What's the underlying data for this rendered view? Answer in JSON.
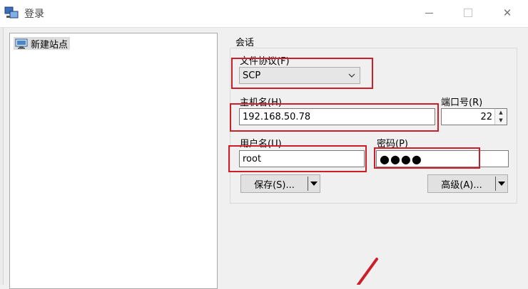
{
  "window": {
    "title": "登录",
    "controls": {
      "minimize_icon": "minimize-icon",
      "maximize_icon": "maximize-icon",
      "close_icon": "close-icon"
    }
  },
  "sidebar": {
    "items": [
      {
        "label": "新建站点",
        "icon": "monitor-icon",
        "selected": true
      }
    ]
  },
  "session": {
    "group_label": "会话",
    "protocol": {
      "label": "文件协议(F)",
      "value": "SCP"
    },
    "host": {
      "label": "主机名(H)",
      "value": "192.168.50.78"
    },
    "port": {
      "label": "端口号(R)",
      "value": "22"
    },
    "user": {
      "label": "用户名(U)",
      "value": "root"
    },
    "password": {
      "label": "密码(P)",
      "value": "●●●●"
    },
    "save_label": "保存(S)...",
    "advanced_label": "高级(A)..."
  },
  "colors": {
    "annotation_red": "#cc1f2a",
    "window_bg": "#f0f0f0",
    "button_bg": "#e1e1e1"
  }
}
